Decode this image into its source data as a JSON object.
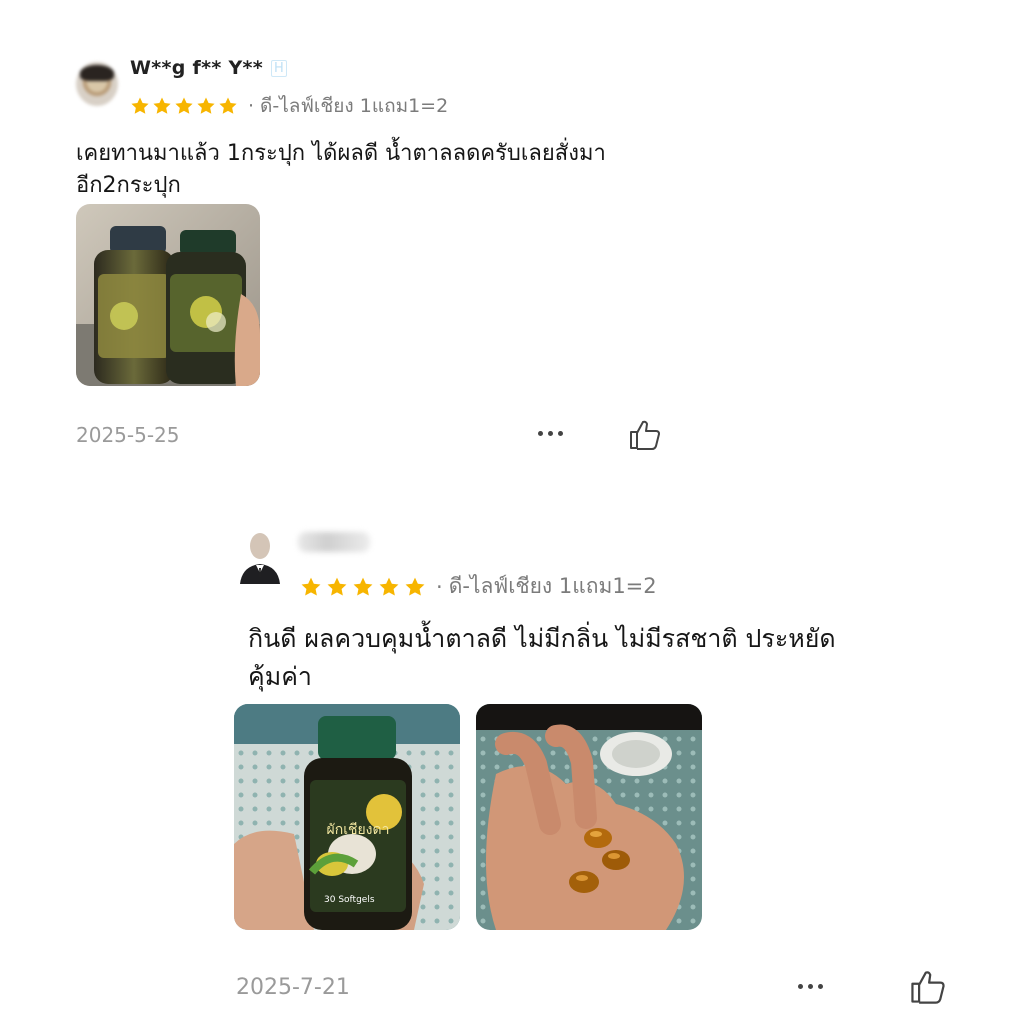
{
  "reviews": [
    {
      "username": "W**g f** Y**",
      "badge": "H",
      "rating": 5,
      "separator": "·",
      "variant": "ดี-ไลฟ์เชียง 1แถม1=2",
      "text_line1": "เคยทานมาแล้ว 1กระปุก ได้ผลดี น้ำตาลลดครับเลยสั่งมา",
      "text_line2": "อีก2กระปุก",
      "date": "2025-5-25"
    },
    {
      "username": "",
      "rating": 5,
      "separator": "·",
      "variant": "ดี-ไลฟ์เชียง 1แถม1=2",
      "text_line1": "กินดี ผลควบคุมน้ำตาลดี ไม่มีกลิ่น ไม่มีรสชาติ ประหยัด",
      "text_line2": "คุ้มค่า",
      "product_label": "30 Softgels",
      "product_name": "ผักเชียงดา",
      "date": "2025-7-21"
    }
  ],
  "colors": {
    "star": "#f7b500",
    "meta_gray": "#7b7b7b",
    "date_gray": "#9a9a9a"
  },
  "icons": {
    "more": "more-dots-icon",
    "like": "thumbs-up-icon",
    "star": "star-icon"
  }
}
